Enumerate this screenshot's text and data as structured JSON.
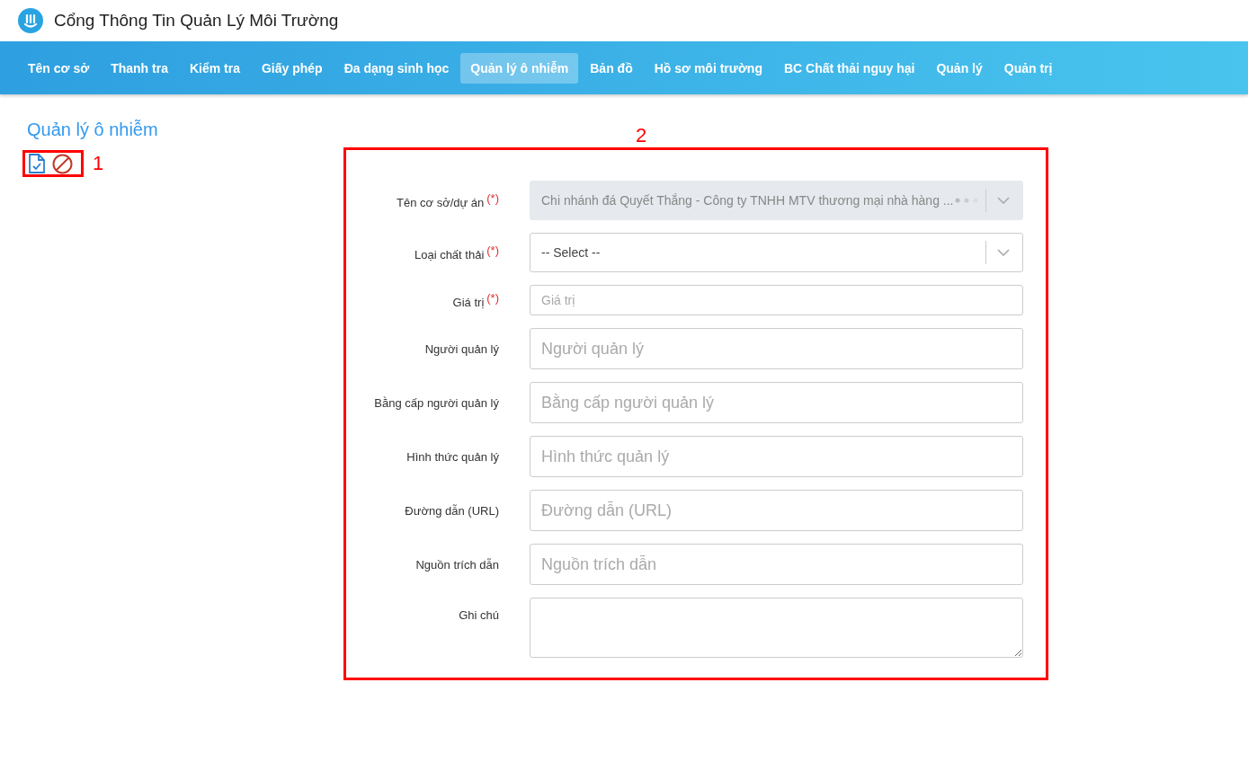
{
  "header": {
    "title": "Cổng Thông Tin Quản Lý Môi Trường"
  },
  "nav": [
    {
      "label": "Tên cơ sở",
      "selected": false
    },
    {
      "label": "Thanh tra",
      "selected": false
    },
    {
      "label": "Kiểm tra",
      "selected": false
    },
    {
      "label": "Giấy phép",
      "selected": false
    },
    {
      "label": "Đa dạng sinh học",
      "selected": false
    },
    {
      "label": "Quản lý ô nhiễm",
      "selected": true
    },
    {
      "label": "Bản đồ",
      "selected": false
    },
    {
      "label": "Hồ sơ môi trường",
      "selected": false
    },
    {
      "label": "BC Chất thải nguy hại",
      "selected": false
    },
    {
      "label": "Quản lý",
      "selected": false
    },
    {
      "label": "Quản trị",
      "selected": false
    }
  ],
  "page_title": "Quản lý ô nhiễm",
  "annotations": [
    {
      "label": "1"
    },
    {
      "label": "2"
    }
  ],
  "form": {
    "fields": [
      {
        "kind": "select",
        "label": "Tên cơ sở/dự án",
        "required_mark": "(*)",
        "value": "Chi nhánh đá Quyết Thắng - Công ty TNHH MTV thương mại nhà hàng ...",
        "disabled": true,
        "loading": true
      },
      {
        "kind": "select",
        "label": "Loại chất thải",
        "required_mark": "(*)",
        "value": "-- Select --",
        "disabled": false,
        "loading": false
      },
      {
        "kind": "compact",
        "label": "Giá trị",
        "required_mark": "(*)",
        "placeholder": "Giá trị"
      },
      {
        "kind": "text",
        "label": "Người quản lý",
        "placeholder": "Người quản lý"
      },
      {
        "kind": "text",
        "label": "Bằng cấp người quản lý",
        "placeholder": "Bằng cấp người quản lý"
      },
      {
        "kind": "text",
        "label": "Hình thức quản lý",
        "placeholder": "Hình thức quản lý"
      },
      {
        "kind": "text",
        "label": "Đường dẫn (URL)",
        "placeholder": "Đường dẫn (URL)"
      },
      {
        "kind": "text",
        "label": "Nguồn trích dẫn",
        "placeholder": "Nguồn trích dẫn"
      },
      {
        "kind": "textarea",
        "label": "Ghi chú"
      }
    ]
  }
}
